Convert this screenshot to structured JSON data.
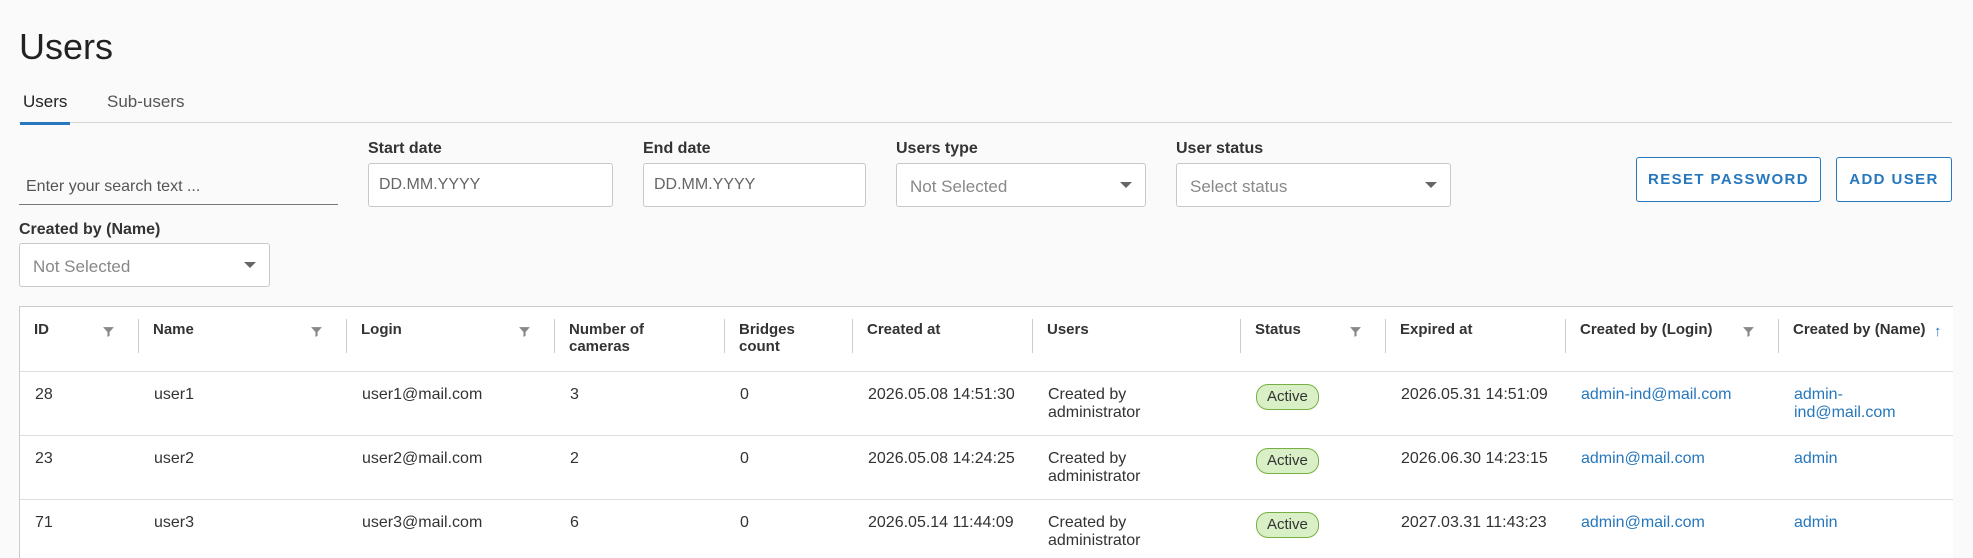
{
  "page": {
    "title": "Users"
  },
  "tabs": [
    {
      "label": "Users",
      "active": true
    },
    {
      "label": "Sub-users",
      "active": false
    }
  ],
  "filters": {
    "search": {
      "placeholder": "Enter your search text ..."
    },
    "start_date": {
      "label": "Start date",
      "placeholder": "DD.MM.YYYY"
    },
    "end_date": {
      "label": "End date",
      "placeholder": "DD.MM.YYYY"
    },
    "users_type": {
      "label": "Users type",
      "value": "Not Selected"
    },
    "user_status": {
      "label": "User status",
      "value": "Select status"
    },
    "created_by_name": {
      "label": "Created by (Name)",
      "value": "Not Selected"
    }
  },
  "actions": {
    "reset_password": "RESET PASSWORD",
    "add_user": "ADD USER"
  },
  "table": {
    "columns": [
      {
        "label": "ID",
        "filter": true
      },
      {
        "label": "Name",
        "filter": true
      },
      {
        "label": "Login",
        "filter": true
      },
      {
        "label": "Number of cameras",
        "filter": false
      },
      {
        "label": "Bridges count",
        "filter": false
      },
      {
        "label": "Created at",
        "filter": false
      },
      {
        "label": "Users",
        "filter": false
      },
      {
        "label": "Status",
        "filter": true
      },
      {
        "label": "Expired at",
        "filter": false
      },
      {
        "label": "Created by (Login)",
        "filter": true
      },
      {
        "label": "Created by (Name)",
        "filter": true,
        "sort": "ascending"
      }
    ],
    "rows": [
      {
        "id": "28",
        "name": "user1",
        "login": "user1@mail.com",
        "cameras": "3",
        "bridges": "0",
        "created_at": "2026.05.08 14:51:30",
        "users": "Created by administrator",
        "status": "Active",
        "expired_at": "2026.05.31 14:51:09",
        "created_by_login": "admin-ind@mail.com",
        "created_by_name": "admin-ind@mail.com"
      },
      {
        "id": "23",
        "name": "user2",
        "login": "user2@mail.com",
        "cameras": "2",
        "bridges": "0",
        "created_at": "2026.05.08 14:24:25",
        "users": "Created by administrator",
        "status": "Active",
        "expired_at": "2026.06.30 14:23:15",
        "created_by_login": "admin@mail.com",
        "created_by_name": "admin"
      },
      {
        "id": "71",
        "name": "user3",
        "login": "user3@mail.com",
        "cameras": "6",
        "bridges": "0",
        "created_at": "2026.05.14 11:44:09",
        "users": "Created by administrator",
        "status": "Active",
        "expired_at": "2027.03.31 11:43:23",
        "created_by_login": "admin@mail.com",
        "created_by_name": "admin"
      }
    ]
  },
  "colors": {
    "accent": "#2677bd",
    "status_active_bg": "#d9efc5",
    "status_active_border": "#76b043"
  },
  "icons": {
    "filter": "filter-icon",
    "sort_ascending": "arrow-up-icon",
    "dropdown": "chevron-down-icon"
  }
}
